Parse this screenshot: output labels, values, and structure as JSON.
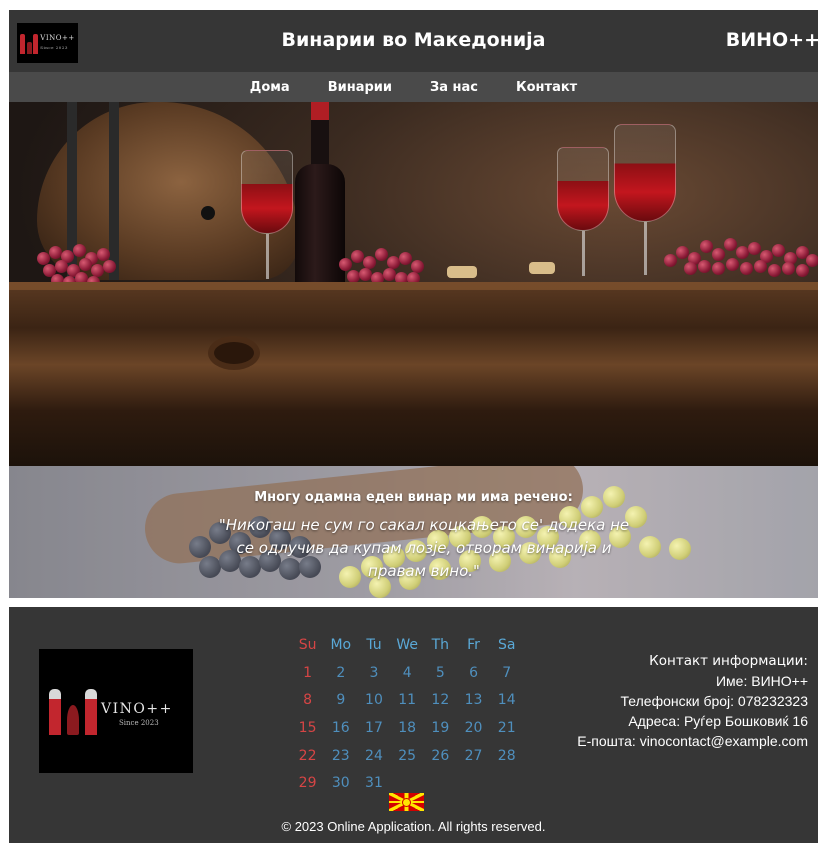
{
  "header": {
    "site_title": "Винарии во Македонија",
    "brand": "ВИНО++",
    "logo_text": "VINO++",
    "logo_since": "Since 2023"
  },
  "nav": {
    "items": [
      {
        "label": "Дома"
      },
      {
        "label": "Винарии"
      },
      {
        "label": "За нас"
      },
      {
        "label": "Контакт"
      }
    ]
  },
  "quote": {
    "intro": "Многу одамна еден винар ми има речено:",
    "text": "\"Никогаш не сум го сакал коцкањето се' додека не се одлучив да купам лозје, отворам винарија и правам вино.\""
  },
  "footer": {
    "logo_text": "VINO++",
    "logo_since": "Since 2023",
    "calendar": {
      "weekdays": [
        "Su",
        "Mo",
        "Tu",
        "We",
        "Th",
        "Fr",
        "Sa"
      ],
      "weeks": [
        [
          "1",
          "2",
          "3",
          "4",
          "5",
          "6",
          "7"
        ],
        [
          "8",
          "9",
          "10",
          "11",
          "12",
          "13",
          "14"
        ],
        [
          "15",
          "16",
          "17",
          "18",
          "19",
          "20",
          "21"
        ],
        [
          "22",
          "23",
          "24",
          "25",
          "26",
          "27",
          "28"
        ],
        [
          "29",
          "30",
          "31",
          "",
          "",
          "",
          ""
        ]
      ],
      "sunday_color": "#d64545",
      "weekday_color": "#4f8fbd"
    },
    "contact": {
      "title": "Контакт информации:",
      "name": "Име: ВИНО++",
      "phone": "Телефонски број: 078232323",
      "address": "Адреса: Руѓер Бошковиќ 16",
      "email": "Е-пошта: vinocontact@example.com"
    },
    "copyright": "© 2023 Online Application. All rights reserved."
  },
  "colors": {
    "header_bg": "#363636",
    "nav_bg": "#4a4a4a",
    "footer_bg": "#363636"
  },
  "icons": {
    "flag": "north-macedonia-flag-icon"
  }
}
